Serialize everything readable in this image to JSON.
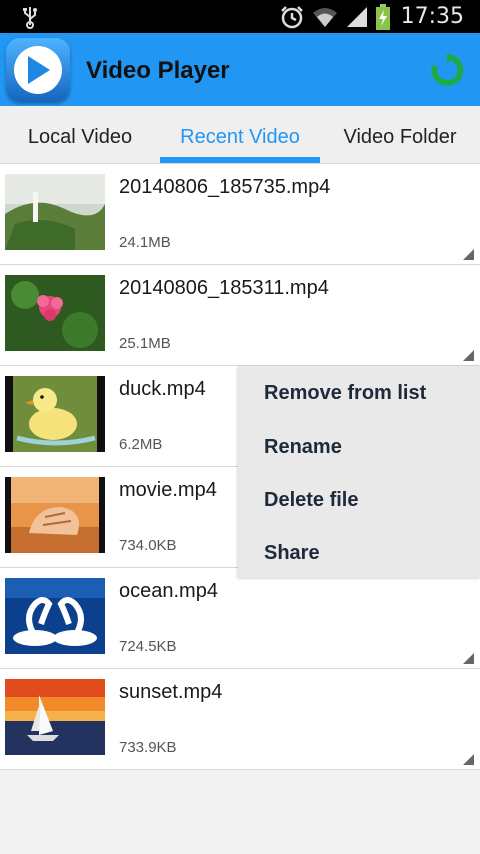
{
  "status_bar": {
    "time": "17:35",
    "icons": [
      "usb-icon",
      "alarm-icon",
      "wifi-icon",
      "signal-icon",
      "battery-charging-icon"
    ]
  },
  "app_bar": {
    "title": "Video Player",
    "logo_icon": "play-logo-icon",
    "action_icon": "refresh-icon"
  },
  "tabs": [
    {
      "label": "Local Video",
      "active": false
    },
    {
      "label": "Recent Video",
      "active": true
    },
    {
      "label": "Video Folder",
      "active": false
    }
  ],
  "videos": [
    {
      "name": "20140806_185735.mp4",
      "size": "24.1MB"
    },
    {
      "name": "20140806_185311.mp4",
      "size": "25.1MB"
    },
    {
      "name": "duck.mp4",
      "size": "6.2MB"
    },
    {
      "name": "movie.mp4",
      "size": "734.0KB"
    },
    {
      "name": "ocean.mp4",
      "size": "724.5KB"
    },
    {
      "name": "sunset.mp4",
      "size": "733.9KB"
    }
  ],
  "context_menu": {
    "items": [
      "Remove from list",
      "Rename",
      "Delete file",
      "Share"
    ]
  },
  "colors": {
    "accent": "#2196f3",
    "status_bar": "#000000",
    "menu_bg": "#e9e9e9"
  }
}
